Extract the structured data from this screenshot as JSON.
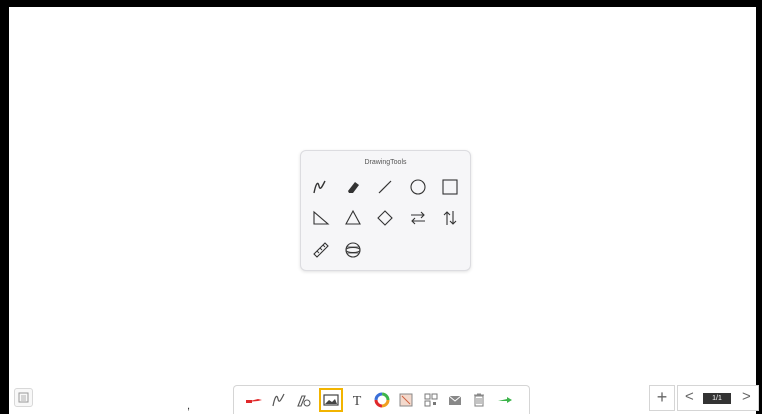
{
  "panel": {
    "title": "DrawingTools",
    "tools": [
      {
        "name": "pen-tool-icon"
      },
      {
        "name": "eraser-tool-icon"
      },
      {
        "name": "line-tool-icon"
      },
      {
        "name": "circle-tool-icon"
      },
      {
        "name": "rectangle-tool-icon"
      },
      {
        "name": "right-triangle-tool-icon"
      },
      {
        "name": "triangle-tool-icon"
      },
      {
        "name": "diamond-tool-icon"
      },
      {
        "name": "horizontal-arrows-tool-icon"
      },
      {
        "name": "vertical-arrows-tool-icon"
      },
      {
        "name": "ruler-tool-icon"
      },
      {
        "name": "sphere-tool-icon"
      }
    ]
  },
  "toolbar": {
    "items": [
      {
        "name": "red-pen-icon",
        "color": "#e0282a"
      },
      {
        "name": "pen-icon"
      },
      {
        "name": "pen-settings-icon"
      },
      {
        "name": "image-icon",
        "active": true,
        "highlight": "#f2b400"
      },
      {
        "name": "text-icon",
        "glyph": "T"
      },
      {
        "name": "color-wheel-icon"
      },
      {
        "name": "screenshot-icon"
      },
      {
        "name": "qr-code-icon"
      },
      {
        "name": "mail-icon"
      },
      {
        "name": "trash-icon"
      },
      {
        "name": "next-arrow-icon",
        "color": "#3cb44a"
      }
    ]
  },
  "pagination": {
    "add_label": "+",
    "prev_label": "<",
    "next_label": ">",
    "page_indicator": "1/1"
  }
}
